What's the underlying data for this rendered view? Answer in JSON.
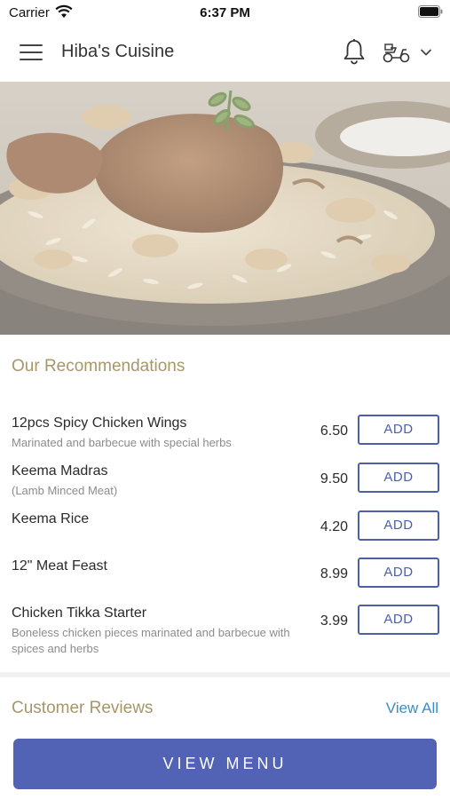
{
  "status_bar": {
    "carrier": "Carrier",
    "time": "6:37 PM",
    "wifi_icon": "wifi-icon",
    "battery_icon": "battery-icon"
  },
  "nav": {
    "menu_icon": "hamburger-menu-icon",
    "title": "Hiba's Cuisine",
    "notification_icon": "bell-icon",
    "delivery_icon": "scooter-icon",
    "dropdown_icon": "chevron-down-icon"
  },
  "hero": {
    "image_subject": "biryani-dish-photo"
  },
  "recommendations": {
    "title": "Our Recommendations",
    "items": [
      {
        "name": "12pcs Spicy Chicken Wings",
        "description": "Marinated and barbecue with special herbs",
        "price": "6.50",
        "button": "ADD"
      },
      {
        "name": "Keema Madras",
        "description": "(Lamb Minced Meat)",
        "price": "9.50",
        "button": "ADD"
      },
      {
        "name": "Keema Rice",
        "description": "",
        "price": "4.20",
        "button": "ADD"
      },
      {
        "name": "12\" Meat Feast",
        "description": "",
        "price": "8.99",
        "button": "ADD"
      },
      {
        "name": "Chicken Tikka Starter",
        "description": "Boneless chicken pieces marinated and barbecue with spices and herbs",
        "price": "3.99",
        "button": "ADD"
      }
    ]
  },
  "reviews": {
    "title": "Customer Reviews",
    "view_all": "View All"
  },
  "cta": {
    "label": "VIEW MENU"
  },
  "colors": {
    "accent": "#5262b4",
    "section_title": "#a6976a",
    "link": "#3a8fc0"
  }
}
